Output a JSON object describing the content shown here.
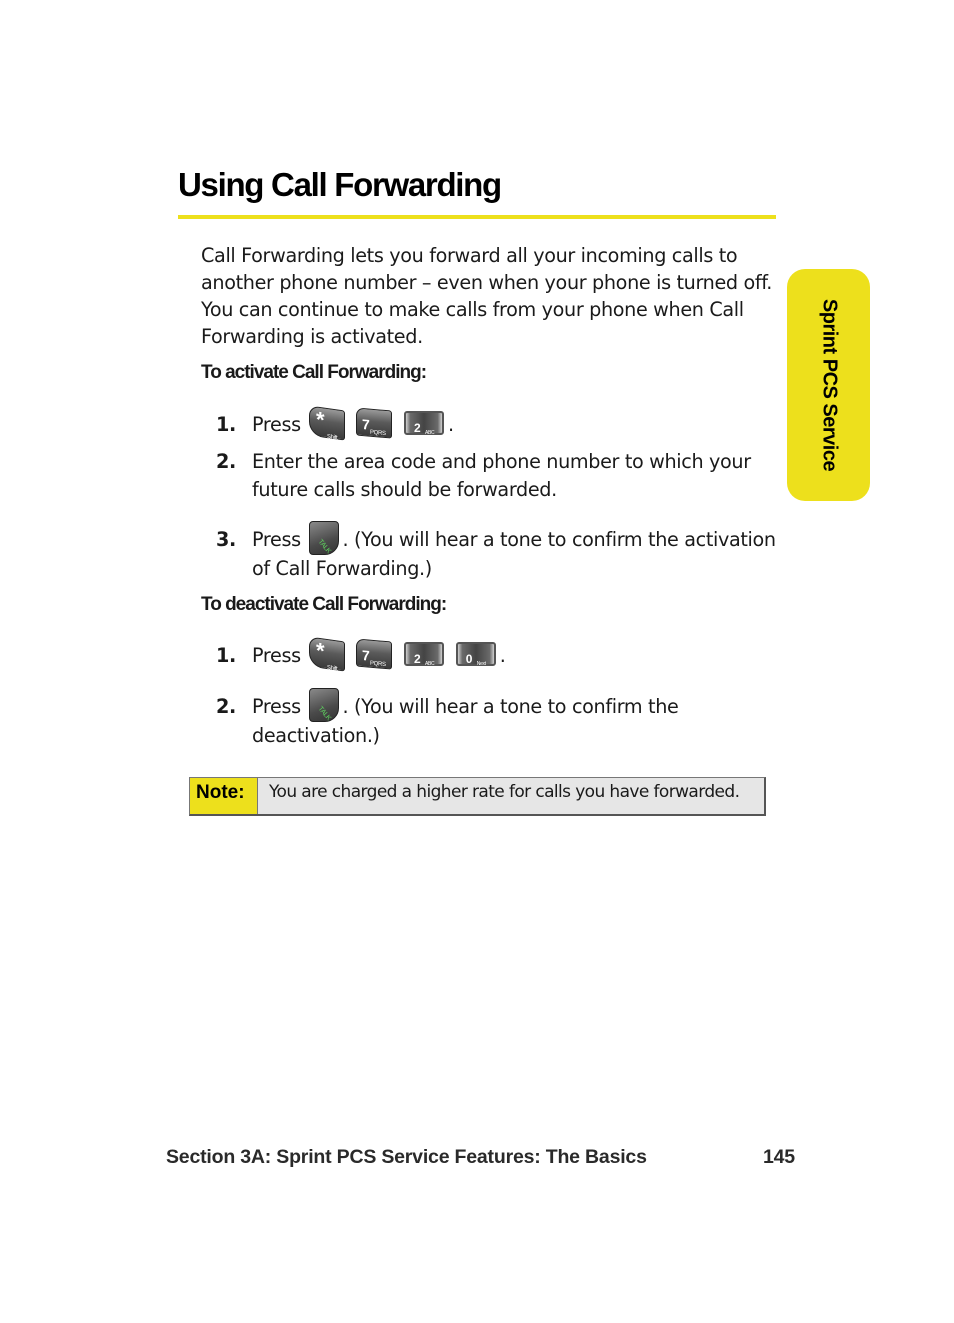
{
  "page": {
    "title": "Using Call Forwarding",
    "intro": "Call Forwarding lets you forward all your incoming calls to another phone number – even when your phone is turned off. You can continue to make calls from your phone when Call Forwarding is activated.",
    "side_tab": "Sprint PCS Service",
    "accent_color": "#ede01c"
  },
  "activate": {
    "heading": "To activate Call Forwarding:",
    "steps": [
      {
        "num": "1.",
        "text": "Press",
        "keys": [
          "star-shift-key",
          "7-pqrs-key",
          "2-abc-key"
        ],
        "after": "."
      },
      {
        "num": "2.",
        "text": "Enter the area code and phone number to which your future calls should be forwarded."
      },
      {
        "num": "3.",
        "text": "Press",
        "keys": [
          "talk-key"
        ],
        "after": ". (You will hear a tone to confirm the activation of Call Forwarding.)"
      }
    ]
  },
  "deactivate": {
    "heading": "To deactivate Call Forwarding:",
    "steps": [
      {
        "num": "1.",
        "text": "Press",
        "keys": [
          "star-shift-key",
          "7-pqrs-key",
          "2-abc-key",
          "0-next-key"
        ],
        "after": "."
      },
      {
        "num": "2.",
        "text": "Press",
        "keys": [
          "talk-key"
        ],
        "after": ". (You will hear a tone to confirm the deactivation.)"
      }
    ]
  },
  "keys": {
    "star": {
      "big": "*",
      "small": "Shift"
    },
    "seven": {
      "big": "7",
      "small": "PQRS"
    },
    "two": {
      "big": "2",
      "small": "ABC"
    },
    "zero": {
      "big": "0",
      "small": "Next"
    },
    "talk": {
      "small": "TALK"
    }
  },
  "note": {
    "label": "Note:",
    "text": "You are charged a higher rate for calls you have forwarded."
  },
  "footer": {
    "section": "Section 3A: Sprint PCS Service Features: The Basics",
    "page_number": "145"
  }
}
